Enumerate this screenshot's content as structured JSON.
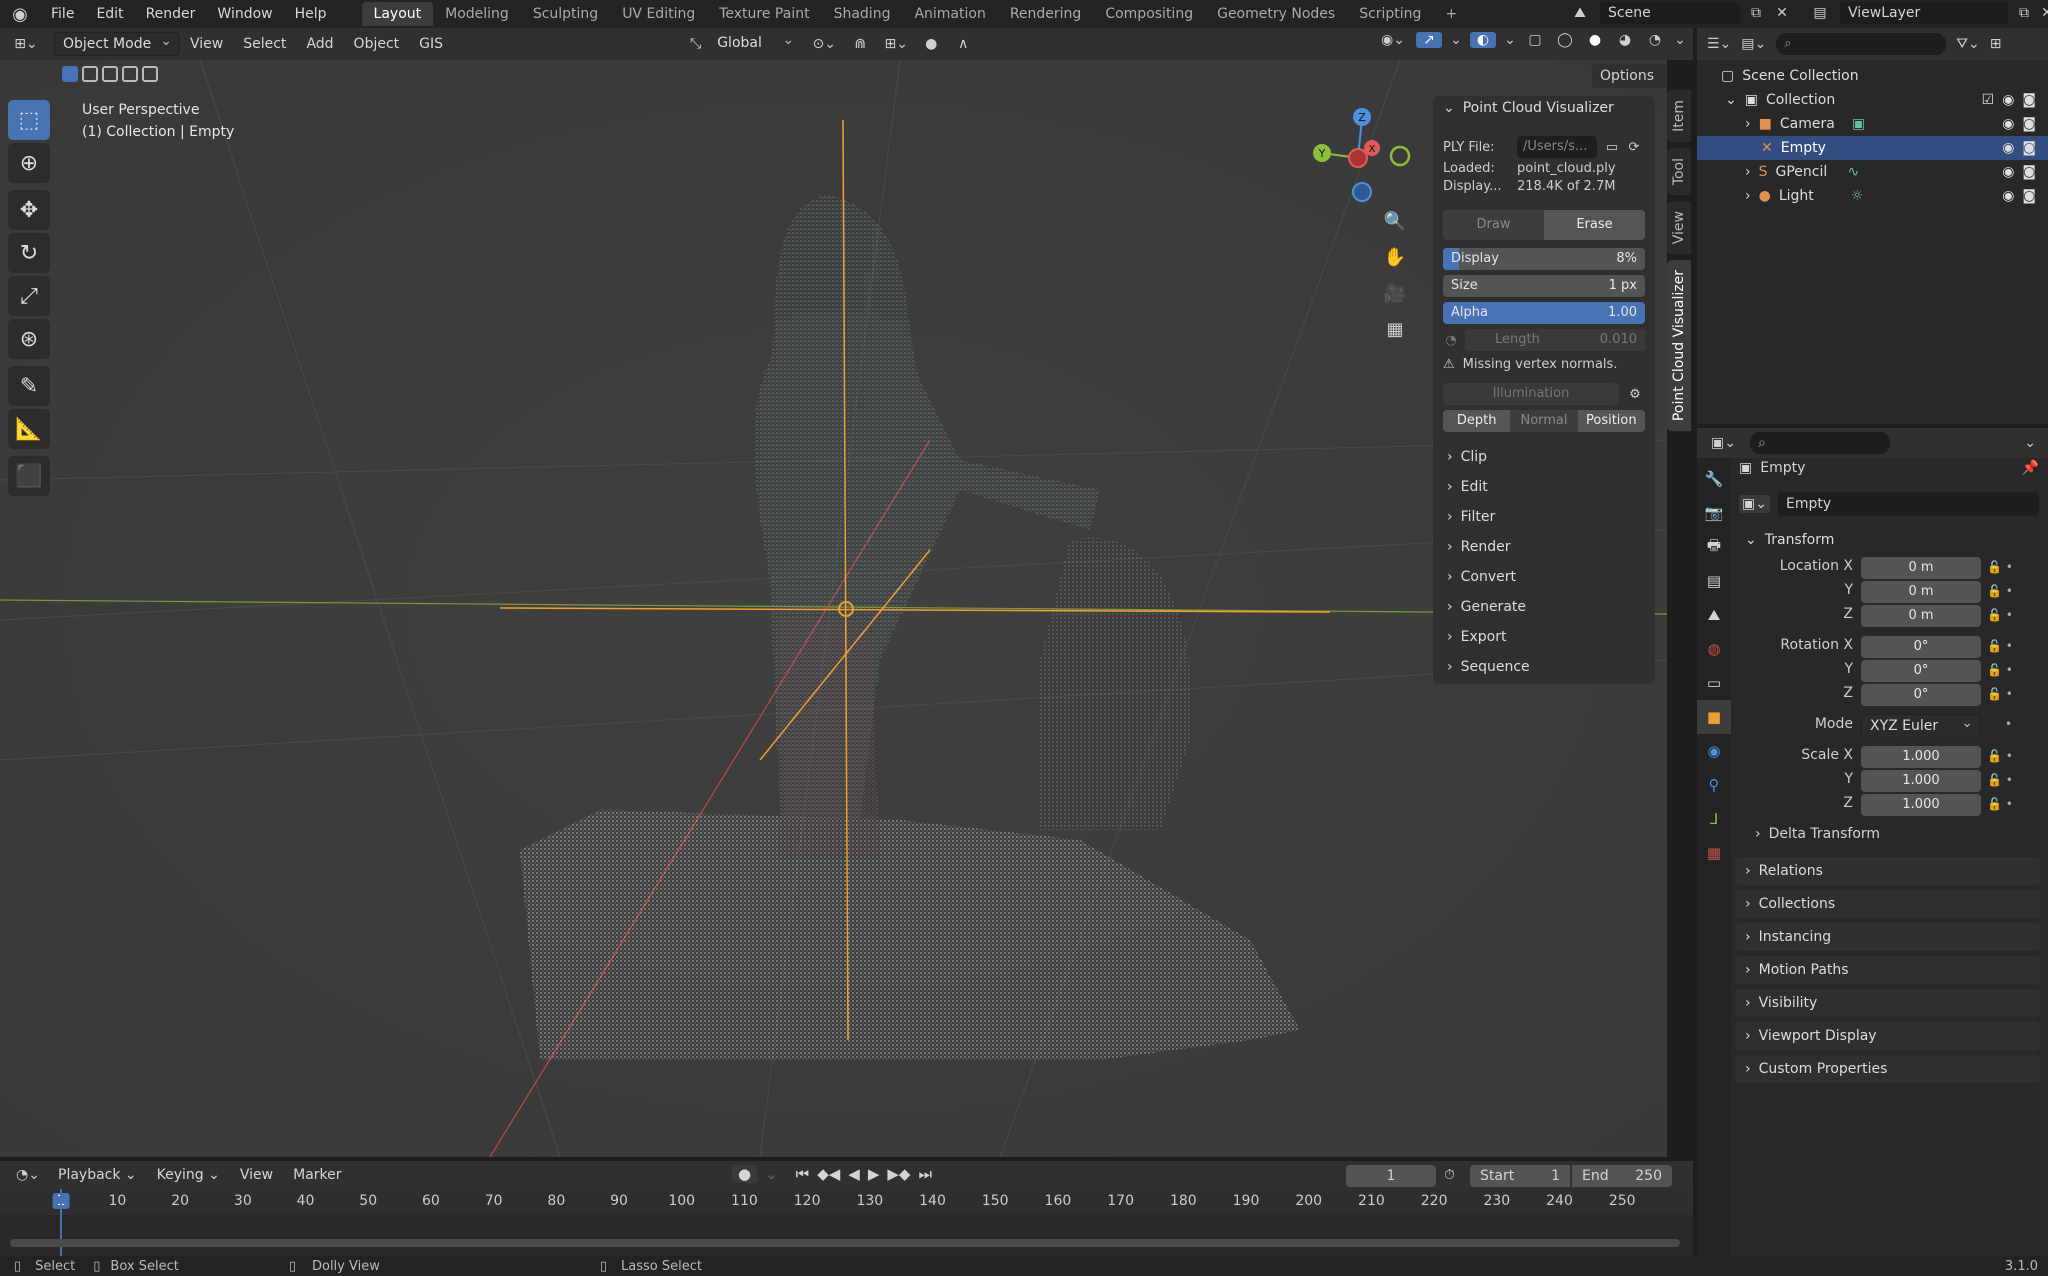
{
  "topbar": {
    "menus": [
      "File",
      "Edit",
      "Render",
      "Window",
      "Help"
    ],
    "workspaces": [
      "Layout",
      "Modeling",
      "Sculpting",
      "UV Editing",
      "Texture Paint",
      "Shading",
      "Animation",
      "Rendering",
      "Compositing",
      "Geometry Nodes",
      "Scripting"
    ],
    "active_workspace": "Layout",
    "add_tab": "+",
    "scene": "Scene",
    "viewlayer": "ViewLayer"
  },
  "viewport_header": {
    "mode": "Object Mode",
    "menus": [
      "View",
      "Select",
      "Add",
      "Object",
      "GIS"
    ],
    "orientation": "Global",
    "options": "Options"
  },
  "viewport": {
    "perspective": "User Perspective",
    "context": "(1) Collection | Empty",
    "gizmo": {
      "x": "X",
      "y": "Y",
      "z": "Z"
    }
  },
  "npanel": {
    "title": "Point Cloud Visualizer",
    "ply_label": "PLY File:",
    "ply_value": "/Users/s...",
    "loaded_label": "Loaded:",
    "loaded_value": "point_cloud.ply",
    "display_label": "Display...",
    "display_value": "218.4K of 2.7M",
    "draw_btn": "Draw",
    "erase_btn": "Erase",
    "display_slider_label": "Display",
    "display_slider_value": "8%",
    "display_fraction": 0.08,
    "size_label": "Size",
    "size_value": "1 px",
    "alpha_label": "Alpha",
    "alpha_value": "1.00",
    "length_label": "Length",
    "length_value": "0.010",
    "warning": "Missing vertex normals.",
    "illumination": "Illumination",
    "shade_modes": [
      "Depth",
      "Normal",
      "Position"
    ],
    "subpanels": [
      "Clip",
      "Edit",
      "Filter",
      "Render",
      "Convert",
      "Generate",
      "Export",
      "Sequence"
    ]
  },
  "side_tabs": [
    "Item",
    "Tool",
    "View",
    "Point Cloud Visualizer"
  ],
  "outliner": {
    "scene_collection": "Scene Collection",
    "collection": "Collection",
    "items": [
      "Camera",
      "Empty",
      "GPencil",
      "Light"
    ]
  },
  "properties": {
    "object_name": "Empty",
    "data_name": "Empty",
    "transform_title": "Transform",
    "location_label": "Location X",
    "rotation_label": "Rotation X",
    "scale_label": "Scale X",
    "y_label": "Y",
    "z_label": "Z",
    "location": [
      "0 m",
      "0 m",
      "0 m"
    ],
    "rotation": [
      "0°",
      "0°",
      "0°"
    ],
    "mode_label": "Mode",
    "mode_value": "XYZ Euler",
    "scale": [
      "1.000",
      "1.000",
      "1.000"
    ],
    "delta": "Delta Transform",
    "panels": [
      "Relations",
      "Collections",
      "Instancing",
      "Motion Paths",
      "Visibility",
      "Viewport Display",
      "Custom Properties"
    ]
  },
  "timeline": {
    "menus": [
      "Playback",
      "Keying",
      "View",
      "Marker"
    ],
    "current_frame": "1",
    "start_label": "Start",
    "start": "1",
    "end_label": "End",
    "end": "250",
    "ticks": [
      "1",
      "10",
      "20",
      "30",
      "40",
      "50",
      "60",
      "70",
      "80",
      "90",
      "100",
      "110",
      "120",
      "130",
      "140",
      "150",
      "160",
      "170",
      "180",
      "190",
      "200",
      "210",
      "220",
      "230",
      "240",
      "250"
    ]
  },
  "statusbar": {
    "select": "Select",
    "box_select": "Box Select",
    "dolly": "Dolly View",
    "lasso": "Lasso Select",
    "version": "3.1.0"
  },
  "colors": {
    "accent": "#4772b3",
    "selected_row": "#334d80",
    "axis_x": "#e05c5c",
    "axis_y": "#8dbf3c",
    "axis_z": "#4f8fe0",
    "origin": "#f0a030"
  }
}
